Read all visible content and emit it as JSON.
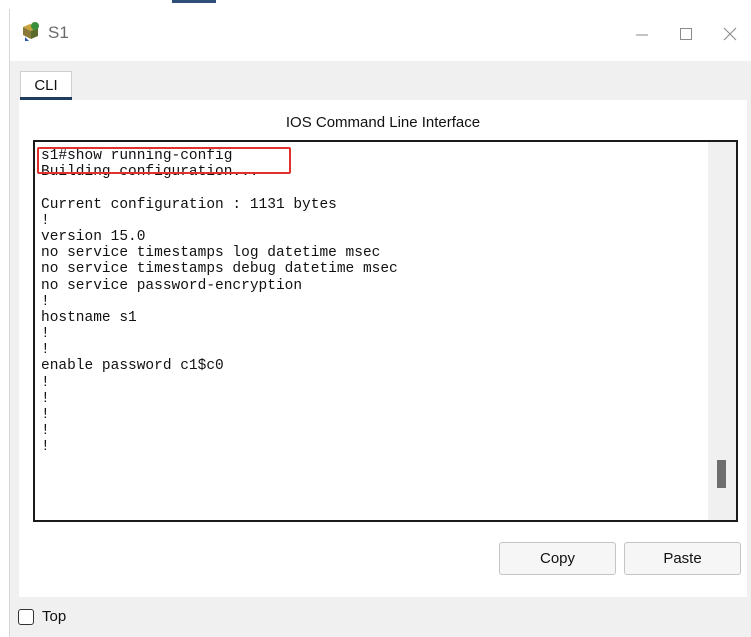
{
  "window": {
    "title": "S1",
    "icon": "switch-device-icon",
    "controls": [
      "minimize-icon",
      "maximize-icon",
      "close-icon"
    ]
  },
  "tabs": [
    {
      "label": "CLI",
      "active": true
    }
  ],
  "panel": {
    "title": "IOS Command Line Interface"
  },
  "terminal": {
    "lines": [
      "s1#show running-config",
      "Building configuration...",
      "",
      "Current configuration : 1131 bytes",
      "!",
      "version 15.0",
      "no service timestamps log datetime msec",
      "no service timestamps debug datetime msec",
      "no service password-encryption",
      "!",
      "hostname s1",
      "!",
      "!",
      "enable password c1$c0",
      "!",
      "!",
      "!",
      "!",
      "!"
    ]
  },
  "buttons": {
    "copy": "Copy",
    "paste": "Paste"
  },
  "footer": {
    "top_label": "Top",
    "top_checked": false
  },
  "colors": {
    "highlight": "#e03030",
    "tab_accent": "#1e3b60"
  }
}
